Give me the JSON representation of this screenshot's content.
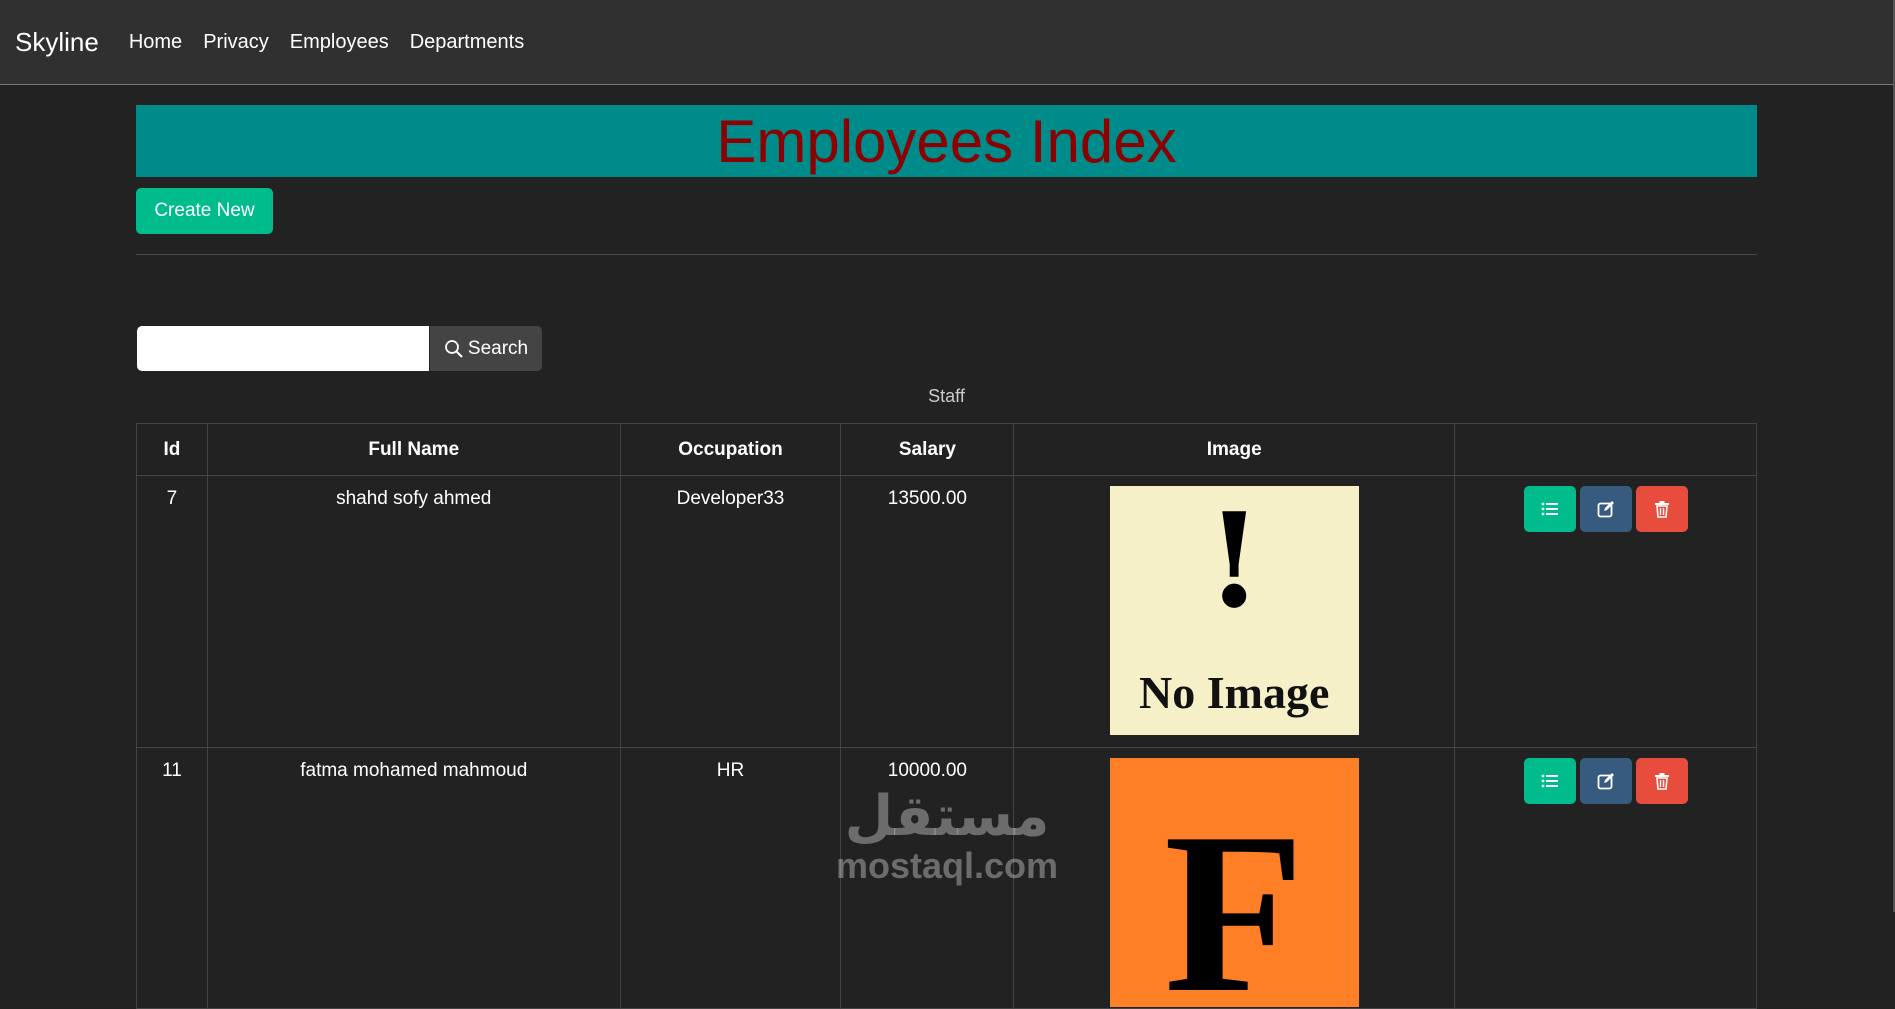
{
  "navbar": {
    "brand": "Skyline",
    "links": [
      "Home",
      "Privacy",
      "Employees",
      "Departments"
    ]
  },
  "page": {
    "title": "Employees Index",
    "create_label": "Create New",
    "search": {
      "value": "",
      "button_label": "Search"
    },
    "table_caption": "Staff"
  },
  "table": {
    "headers": [
      "Id",
      "Full Name",
      "Occupation",
      "Salary",
      "Image",
      ""
    ],
    "rows": [
      {
        "id": "7",
        "full_name": "shahd sofy ahmed",
        "occupation": "Developer33",
        "salary": "13500.00",
        "image": {
          "type": "placeholder",
          "text": "No Image"
        }
      },
      {
        "id": "11",
        "full_name": "fatma mohamed mahmoud",
        "occupation": "HR",
        "salary": "10000.00",
        "image": {
          "type": "letter",
          "text": "F"
        }
      }
    ]
  },
  "colors": {
    "navbar_bg": "#303030",
    "body_bg": "#222222",
    "title_bg": "#008b8b",
    "title_text": "#8b0000",
    "success": "#00bc8c",
    "primary": "#375a7f",
    "danger": "#e74c3c"
  },
  "icons": {
    "search": "search-icon",
    "details": "list-icon",
    "edit": "edit-icon",
    "delete": "trash-icon"
  },
  "watermark": {
    "arabic": "مستقل",
    "latin": "mostaql.com"
  }
}
